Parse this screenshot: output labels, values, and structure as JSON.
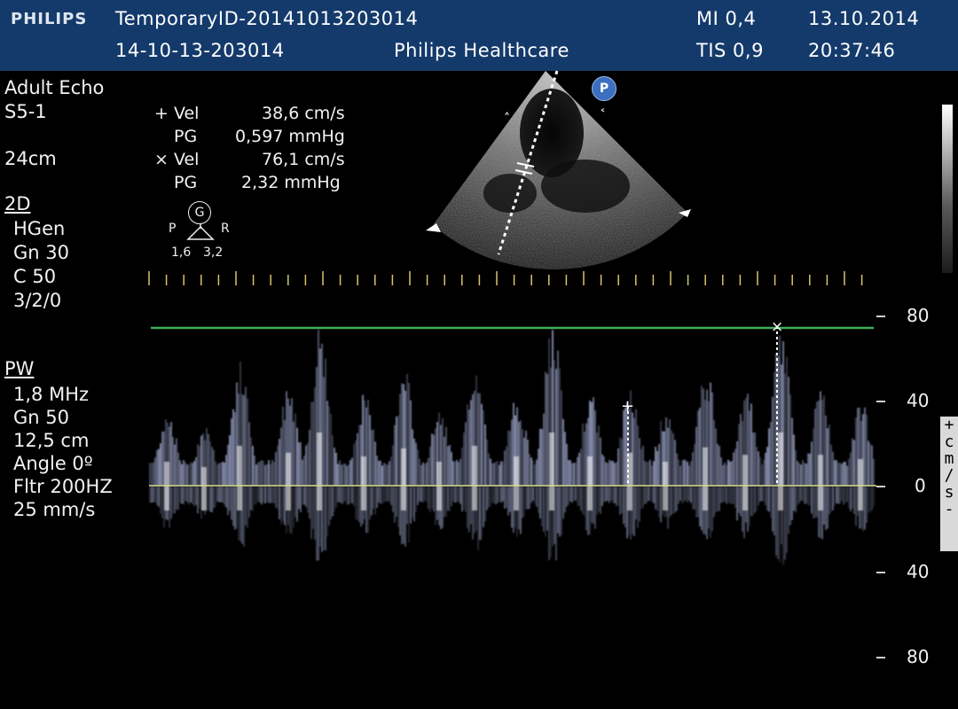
{
  "header": {
    "logo": "PHILIPS",
    "patient_id": "TemporaryID-20141013203014",
    "exam_id": "14-10-13-203014",
    "institution": "Philips Healthcare",
    "mi": "MI 0,4",
    "tis": "TIS 0,9",
    "date": "13.10.2014",
    "time": "20:37:46"
  },
  "left_panel": {
    "preset": "Adult Echo",
    "probe": "S5-1",
    "depth": "24cm",
    "mode_2d": "2D",
    "params_2d": [
      "HGen",
      "Gn 30",
      "C 50",
      "3/2/0"
    ],
    "mode_pw": "PW",
    "params_pw": [
      "1,8 MHz",
      "Gn 50",
      "12,5 cm",
      "Angle 0º",
      "Fltr 200HZ",
      "25 mm/s"
    ]
  },
  "measurements": [
    {
      "marker": "+ Vel",
      "value": "38,6 cm/s"
    },
    {
      "marker": "PG",
      "value": "0,597 mmHg"
    },
    {
      "marker": "× Vel",
      "value": "76,1 cm/s"
    },
    {
      "marker": "PG",
      "value": "2,32 mmHg"
    }
  ],
  "orientation": {
    "g": "G",
    "p": "P",
    "r": "R",
    "left_val": "1,6",
    "right_val": "3,2",
    "badge": "P"
  },
  "velocity_scale": {
    "labels": [
      "80",
      "40",
      "0",
      "40",
      "80"
    ],
    "unit": [
      "+",
      "c",
      "m",
      "/",
      "s",
      "-"
    ]
  },
  "colors": {
    "header_bg": "#143a6b",
    "baseline": "#d7e08a",
    "envelope_line": "#3caf5a",
    "spectrum": "#b8c2ee"
  }
}
